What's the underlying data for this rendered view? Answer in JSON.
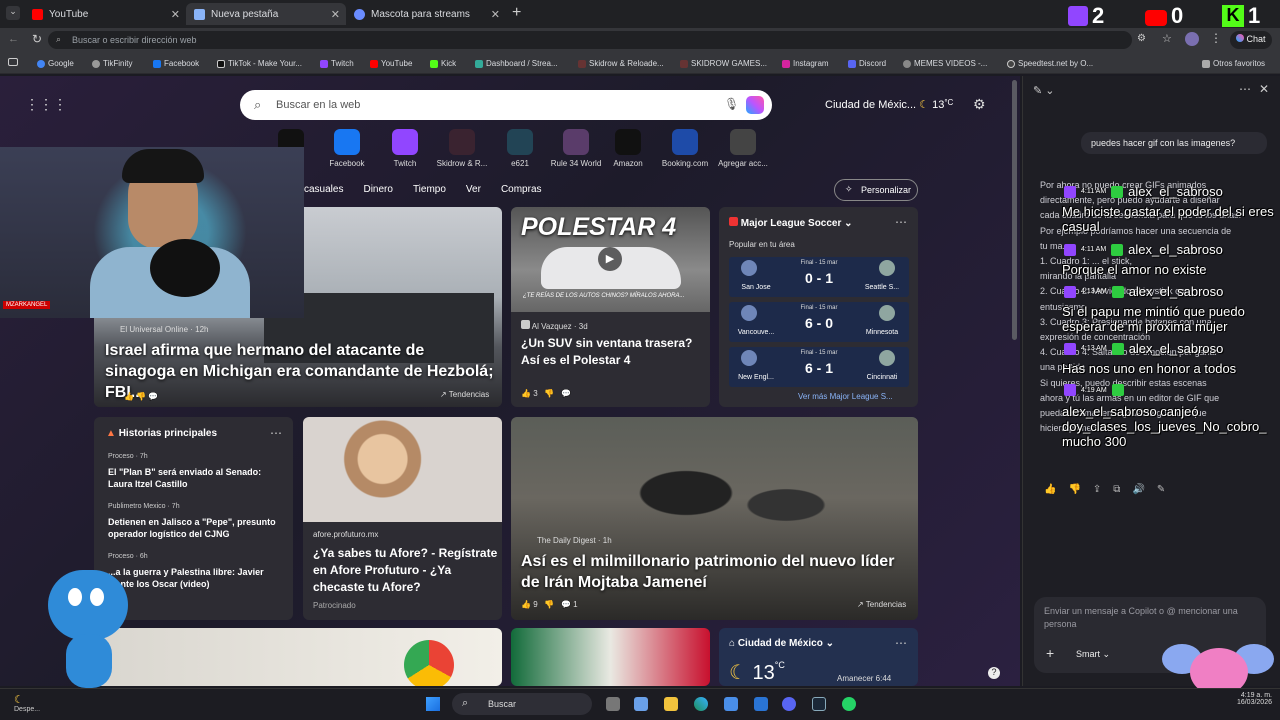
{
  "tabs": [
    {
      "label": "YouTube"
    },
    {
      "label": "Nueva pestaña"
    },
    {
      "label": "Mascota para streams"
    }
  ],
  "overlay_counts": {
    "twitch": "2",
    "youtube": "0",
    "kick": "1"
  },
  "address": {
    "placeholder": "Buscar o escribir dirección web",
    "chat_label": "Chat"
  },
  "bookmarks": [
    "Google",
    "TikFinity",
    "Facebook",
    "TikTok - Make Your...",
    "Twitch",
    "YouTube",
    "Kick",
    "Dashboard / Strea...",
    "Skidrow & Reloade...",
    "SKIDROW GAMES...",
    "Instagram",
    "Discord",
    "MEMES VIDEOS -...",
    "Speedtest.net by O...",
    "Otros favoritos"
  ],
  "ntp": {
    "search_placeholder": "Buscar en la web",
    "weather": "Ciudad de Méxic...",
    "temp": "13",
    "temp_unit": "°C",
    "shortcuts": [
      "ctok",
      "Facebook",
      "Twitch",
      "Skidrow & R...",
      "e621",
      "Rule 34 World",
      "Amazon",
      "Booking.com",
      "Agregar acc..."
    ],
    "nav": [
      "casuales",
      "Dinero",
      "Tiempo",
      "Ver",
      "Compras"
    ],
    "personalize": "Personalizar"
  },
  "cards": {
    "main": {
      "source": "El Universal Online · 12h",
      "headline": "Israel afirma que hermano del atacante de sinagoga en Michigan era comandante de Hezbolá; FBI...",
      "trend": "Tendencias"
    },
    "polestar": {
      "banner": "POLESTAR 4",
      "caption": "¿TE REÍAS DE LOS AUTOS CHINOS? MÍRALOS AHORA...",
      "source": "Al Vazquez · 3d",
      "headline": "¿Un SUV sin ventana trasera? Así es el Polestar 4",
      "likes": "3"
    },
    "mls": {
      "title": "Major League Soccer",
      "subtitle": "Popular en tu área",
      "more": "Ver más Major League S...",
      "games": [
        {
          "home": "San Jose",
          "away": "Seattle S...",
          "status": "Final - 15 mar",
          "score": "0 - 1"
        },
        {
          "home": "Vancouve...",
          "away": "Minnesota",
          "status": "Final - 15 mar",
          "score": "6 - 0"
        },
        {
          "home": "New Engl...",
          "away": "Cincinnati",
          "status": "Final - 15 mar",
          "score": "6 - 1"
        }
      ]
    },
    "top": {
      "title": "Historias principales",
      "items": [
        {
          "src": "Proceso · 7h",
          "text": "El \"Plan B\" será enviado al Senado: Laura Itzel Castillo"
        },
        {
          "src": "Publimetro Mexico · 7h",
          "text": "Detienen en Jalisco a \"Pepe\", presunto operador logístico del CJNG"
        },
        {
          "src": "Proceso · 6h",
          "text": "...a la guerra y Palestina libre: Javier ...ante los Oscar (video)"
        }
      ]
    },
    "afore": {
      "source": "afore.profuturo.mx",
      "headline": "¿Ya sabes tu Afore? - Regístrate en Afore Profuturo - ¿Ya checaste tu Afore?",
      "sponsor": "Patrocinado"
    },
    "iran": {
      "source": "The Daily Digest · 1h",
      "headline": "Así es el milmillonario patrimonio del nuevo líder de Irán Mojtaba Jameneí",
      "likes": "9",
      "comments": "1",
      "trend": "Tendencias"
    },
    "weather2": {
      "title": "Ciudad de México",
      "temp": "13",
      "sunrise": "Amanecer 6:44"
    }
  },
  "copilot": {
    "user_msg": "puedes hacer gif con las imagenes?",
    "reply": [
      "Por ahora no puedo crear GIFs animados",
      "directamente, pero puedo ayudarte a diseñar",
      "cada cuadro de la secuencia para que tú los unas.",
      "Por ejemplo podríamos hacer una secuencia de",
      "tu ma...",
      "1. Cuadro 1: ... el stick,",
      "mirando la pantalla",
      "2. Cuadro 2: Moviendo el joystick con",
      "entusiasmo",
      "3. Cuadro 3: Presionando botones con una",
      "expresión de concentración",
      "4. Cuadro 4: Saltando de emoción por ganar",
      "una partida",
      "Si quieres, puedo describir estas escenas",
      "ahora y tú las armas en un editor de GIF que",
      "puedas animar en... ¿cuál te gustaría que",
      "hiciera primero?"
    ],
    "input_placeholder": "Enviar un mensaje a Copilot o @ mencionar una persona",
    "mode": "Smart"
  },
  "stream_chat": [
    {
      "time": "4:11 AM",
      "user": "alex_el_sabroso",
      "msg": "Me hiciste gastar el poder del si eres casual"
    },
    {
      "time": "4:11 AM",
      "user": "alex_el_sabroso",
      "msg": "Porque el amor no existe"
    },
    {
      "time": "4:13 AM",
      "user": "alex_el_sabroso",
      "msg": "Si el papu me mintió que puedo esperar de mi próxima mujer"
    },
    {
      "time": "4:13 AM",
      "user": "alex_el_sabroso",
      "msg": "Has nos uno en honor a todos"
    },
    {
      "time": "4:19 AM",
      "user": "",
      "msg": "alex_el_sabroso canjeó doy_clases_los_jueves_No_cobro_ mucho 300"
    }
  ],
  "webcam_label": "MZARKANGEL",
  "taskbar": {
    "search": "Buscar",
    "time": "4:19 a. m.",
    "date": "16/03/2026",
    "weather_text": "Despe..."
  },
  "colors": {
    "accent": "#5b5bd6",
    "twitch": "#9146ff",
    "youtube": "#ff0000",
    "kick": "#53fc18"
  }
}
